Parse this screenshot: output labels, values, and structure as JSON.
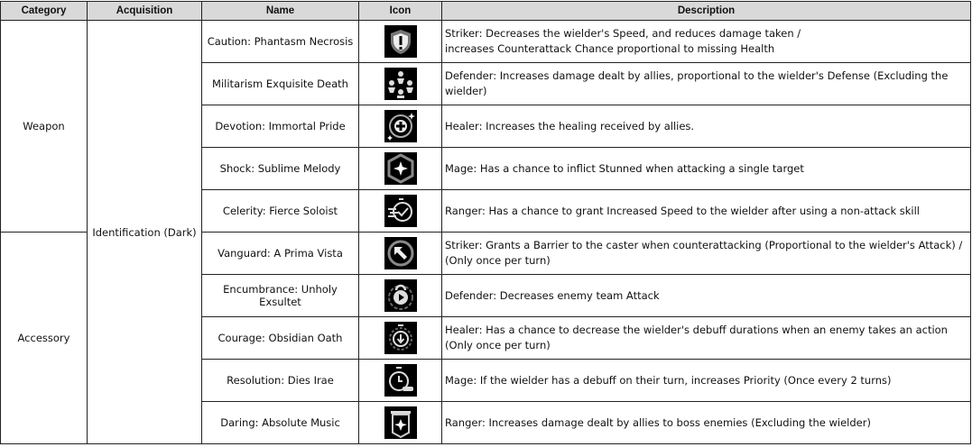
{
  "headers": [
    "Category",
    "Acquisition",
    "Name",
    "Icon",
    "Description"
  ],
  "categories": [
    "Weapon",
    "Accessory"
  ],
  "acquisition": "Identification (Dark)",
  "rows": [
    {
      "name": "Caution: Phantasm Necrosis",
      "icon": "shield-exclamation-icon",
      "desc1": "Striker: Decreases the wielder's Speed, and reduces damage taken /",
      "desc2": "increases Counterattack Chance proportional to missing Health"
    },
    {
      "name": "Militarism Exquisite Death",
      "icon": "allies-circle-icon",
      "desc1": "Defender: Increases damage dealt by allies, proportional to the wielder's Defense (Excluding the wielder)",
      "desc2": ""
    },
    {
      "name": "Devotion: Immortal Pride",
      "icon": "healing-cross-icon",
      "desc1": "Healer: Increases the healing received by allies.",
      "desc2": ""
    },
    {
      "name": "Shock: Sublime Melody",
      "icon": "stun-star-icon",
      "desc1": "Mage: Has a chance to inflict Stunned when attacking a single target",
      "desc2": ""
    },
    {
      "name": "Celerity: Fierce Soloist",
      "icon": "speed-stopwatch-icon",
      "desc1": "Ranger: Has a chance to grant Increased Speed to the wielder after using a non-attack skill",
      "desc2": ""
    },
    {
      "name": "Vanguard: A Prima Vista",
      "icon": "counter-arrow-icon",
      "desc1": "Striker: Grants a Barrier to the caster when counterattacking (Proportional to the wielder's Attack) /",
      "desc2": "(Only once per turn)"
    },
    {
      "name": "Encumbrance: Unholy Exsultet",
      "icon": "lock-play-icon",
      "desc1": "Defender: Decreases enemy team Attack",
      "desc2": ""
    },
    {
      "name": "Courage: Obsidian Oath",
      "icon": "stopwatch-down-icon",
      "desc1": "Healer: Has a chance to decrease the wielder's debuff durations when an enemy takes an action",
      "desc2": "(Only once per turn)"
    },
    {
      "name": "Resolution: Dies Irae",
      "icon": "stopwatch-priority-icon",
      "desc1": "Mage: If the wielder has a debuff on their turn, increases Priority (Once every 2 turns)",
      "desc2": ""
    },
    {
      "name": "Daring: Absolute Music",
      "icon": "banner-icon",
      "desc1": "Ranger: Increases damage dealt by allies to boss enemies (Excluding the wielder)",
      "desc2": ""
    }
  ]
}
